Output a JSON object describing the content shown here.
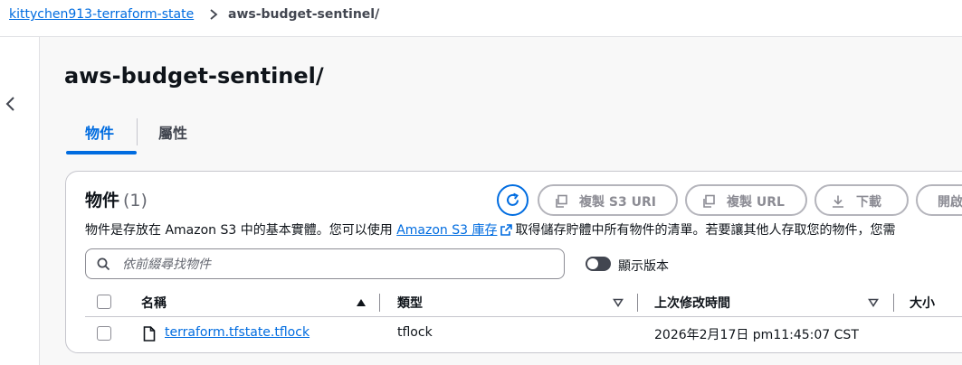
{
  "breadcrumb": {
    "bucket": "kittychen913-terraform-state",
    "current": "aws-budget-sentinel/"
  },
  "page": {
    "title": "aws-budget-sentinel/"
  },
  "tabs": [
    {
      "label": "物件",
      "active": true
    },
    {
      "label": "屬性",
      "active": false
    }
  ],
  "panel": {
    "heading": "物件",
    "count": "(1)",
    "buttons": {
      "copy_s3_uri": "複製 S3 URI",
      "copy_url": "複製 URL",
      "download": "下載",
      "open": "開啟"
    },
    "description": {
      "before": "物件是存放在 Amazon S3 中的基本實體。您可以使用",
      "link": "Amazon S3 庫存",
      "after": "取得儲存貯體中所有物件的清單。若要讓其他人存取您的物件，您需"
    },
    "search": {
      "placeholder": "依前綴尋找物件",
      "value": ""
    },
    "show_versions": {
      "label": "顯示版本",
      "enabled": false
    }
  },
  "table": {
    "columns": {
      "name": "名稱",
      "type": "類型",
      "last_modified": "上次修改時間",
      "size": "大小"
    },
    "rows": [
      {
        "name": "terraform.tfstate.tflock",
        "type": "tflock",
        "last_modified": "2026年2月17日 pm11:45:07 CST"
      }
    ]
  },
  "icons": {
    "breadcrumb_separator": "chevron-right-icon",
    "back": "chevron-left-icon",
    "refresh": "refresh-icon",
    "copy": "copy-icon",
    "download": "download-icon",
    "external_link": "external-link-icon",
    "search": "search-icon",
    "sort_ascending": "caret-up-icon",
    "sort_descending": "caret-down-icon",
    "file": "file-icon"
  },
  "colors": {
    "accent": "#006ce0",
    "text": "#0f141a",
    "disabled": "#8c8c94",
    "toggle_off": "#424650"
  }
}
